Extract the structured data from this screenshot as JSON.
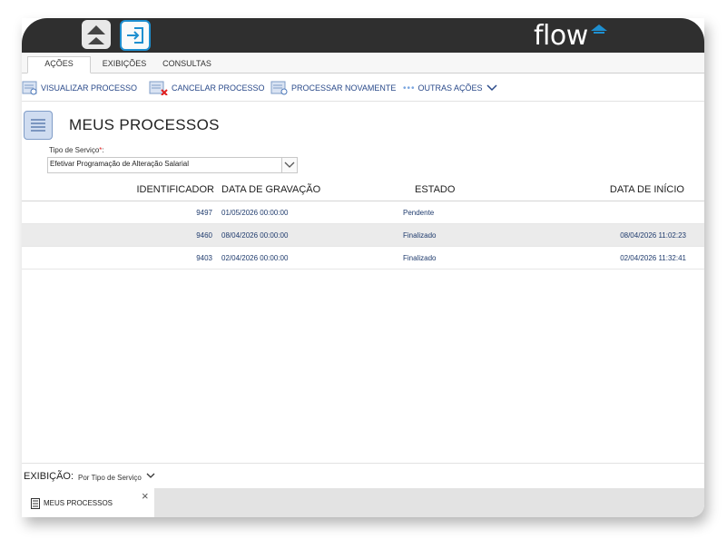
{
  "tabs": [
    "Ações",
    "Exibições",
    "Consultas"
  ],
  "logo": "flow",
  "toolbar": {
    "view": "Visualizar Processo",
    "cancel": "Cancelar Processo",
    "reprocess": "Processar Novamente",
    "more": "Outras Ações"
  },
  "page_title": "MEUS PROCESSOS",
  "service_field": {
    "label": "Tipo de Serviço",
    "required_mark": "*",
    "colon": ":",
    "value": "Efetivar Programação de Alteração Salarial"
  },
  "table": {
    "columns": [
      "Identificador",
      "Data de Gravação",
      "Estado",
      "Data de Início"
    ],
    "rows": [
      {
        "id": "9497",
        "saved": "01/05/2026 00:00:00",
        "state": "Pendente",
        "start": ""
      },
      {
        "id": "9460",
        "saved": "08/04/2026 00:00:00",
        "state": "Finalizado",
        "start": "08/04/2026 11:02:23"
      },
      {
        "id": "9403",
        "saved": "02/04/2026 00:00:00",
        "state": "Finalizado",
        "start": "02/04/2026 11:32:41"
      }
    ]
  },
  "footer": {
    "label": "EXIBIÇÃO:",
    "value": "Por Tipo de Serviço"
  },
  "task": {
    "label": "Meus Processos",
    "close": "×"
  },
  "colors": {
    "topbar": "#2f2f2f",
    "accent": "#1e8fd0",
    "link": "#2a4a8a",
    "alt_row": "#ebebeb"
  },
  "icons": [
    "home-icon",
    "exit-icon",
    "logo-triangle-icon",
    "view-process-icon",
    "cancel-process-icon",
    "reprocess-icon",
    "dots-icon",
    "chevron-down-icon",
    "list-icon",
    "close-icon"
  ]
}
